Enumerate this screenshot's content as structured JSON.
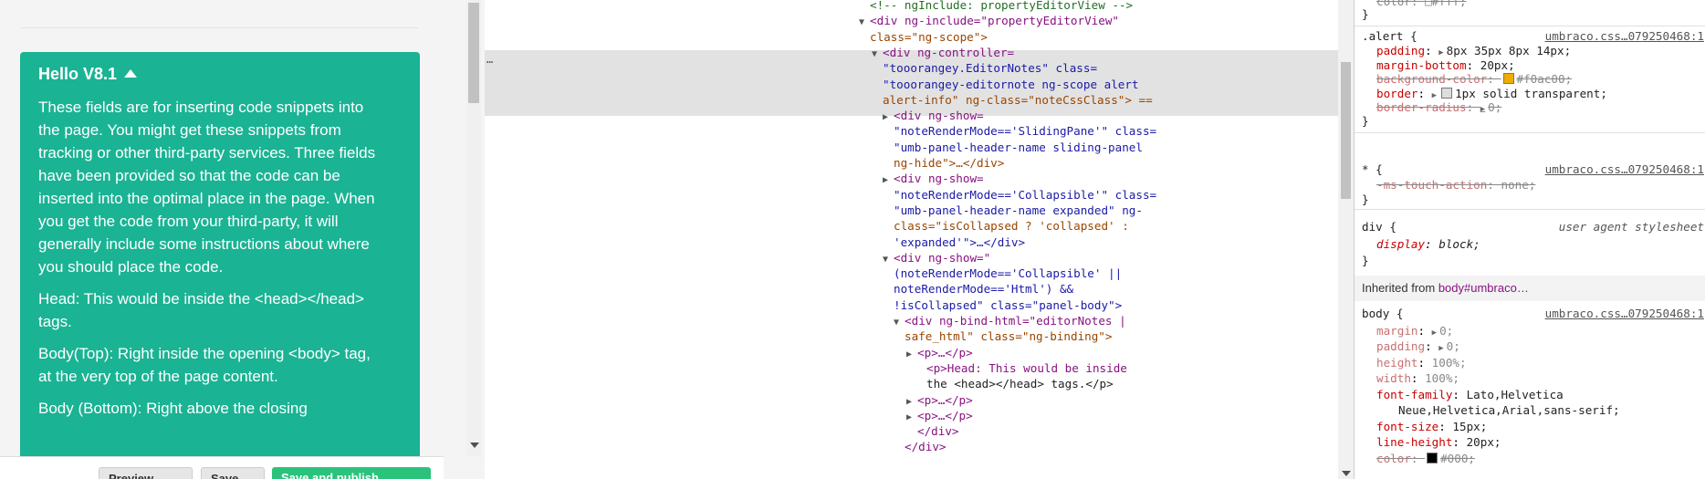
{
  "note": {
    "title": "Hello V8.1",
    "paragraphs": [
      "These fields are for inserting code snippets into the page. You might get these snippets from tracking or other third-party services. Three fields have been provided so that the code can be inserted into the optimal place in the page. When you get the code from your third-party, it will generally include some instructions about where you should place the code.",
      "Head: This would be inside the <head></head> tags.",
      "Body(Top): Right inside the opening <body> tag, at the very top of the page content.",
      "Body (Bottom): Right above the closing"
    ]
  },
  "buttons": {
    "preview": "Preview",
    "save": "Save",
    "publish": "Save and publish"
  },
  "elements_panel": {
    "dots": "…",
    "lines": [
      {
        "indent": 0,
        "tri": "",
        "html": "<!-- ngInclude: propertyEditorView -->"
      },
      {
        "indent": 0,
        "tri": "▼",
        "html": "<div ng-include=\"propertyEditorView\""
      },
      {
        "indent": 0,
        "tri": "",
        "html": "class=\"ng-scope\">"
      },
      {
        "indent": 1,
        "tri": "▼",
        "html": "<div ng-controller="
      },
      {
        "indent": 1,
        "tri": "",
        "html": "\"tooorangey.EditorNotes\" class="
      },
      {
        "indent": 1,
        "tri": "",
        "html": "\"tooorangey-editornote ng-scope alert"
      },
      {
        "indent": 1,
        "tri": "",
        "html": "alert-info\" ng-class=\"noteCssClass\"> =="
      },
      {
        "indent": 2,
        "tri": "▶",
        "html": "<div ng-show="
      },
      {
        "indent": 2,
        "tri": "",
        "html": "\"noteRenderMode=='SlidingPane'\" class="
      },
      {
        "indent": 2,
        "tri": "",
        "html": "\"umb-panel-header-name sliding-panel"
      },
      {
        "indent": 2,
        "tri": "",
        "html": "ng-hide\">…</div>"
      },
      {
        "indent": 2,
        "tri": "▶",
        "html": "<div ng-show="
      },
      {
        "indent": 2,
        "tri": "",
        "html": "\"noteRenderMode=='Collapsible'\" class="
      },
      {
        "indent": 2,
        "tri": "",
        "html": "\"umb-panel-header-name expanded\" ng-"
      },
      {
        "indent": 2,
        "tri": "",
        "html": "class=\"isCollapsed ? 'collapsed' :"
      },
      {
        "indent": 2,
        "tri": "",
        "html": "'expanded'\">…</div>"
      },
      {
        "indent": 2,
        "tri": "▼",
        "html": "<div ng-show=\""
      },
      {
        "indent": 2,
        "tri": "",
        "html": "(noteRenderMode=='Collapsible' ||"
      },
      {
        "indent": 2,
        "tri": "",
        "html": "noteRenderMode=='Html') &&"
      },
      {
        "indent": 2,
        "tri": "",
        "html": "!isCollapsed\" class=\"panel-body\">"
      },
      {
        "indent": 3,
        "tri": "▼",
        "html": "<div ng-bind-html=\"editorNotes |"
      },
      {
        "indent": 3,
        "tri": "",
        "html": "safe_html\" class=\"ng-binding\">"
      },
      {
        "indent": 4,
        "tri": "▶",
        "html": "<p>…</p>"
      },
      {
        "indent": 5,
        "tri": "",
        "html": "<p>Head: This would be inside"
      },
      {
        "indent": 5,
        "tri": "",
        "html": "the <head></head> tags.</p>"
      },
      {
        "indent": 4,
        "tri": "▶",
        "html": "<p>…</p>"
      },
      {
        "indent": 4,
        "tri": "▶",
        "html": "<p>…</p>"
      },
      {
        "indent": 4,
        "tri": "",
        "html": "</div>"
      },
      {
        "indent": 3,
        "tri": "",
        "html": "</div>"
      }
    ]
  },
  "styles_panel": {
    "top_color": "color: □#fff;",
    "alert_rule": {
      "selector": ".alert {",
      "source": "umbraco.css…079250468:1",
      "props": [
        {
          "name": "padding",
          "value": "8px 35px 8px 14px;",
          "struck": false,
          "tri": true
        },
        {
          "name": "margin-bottom",
          "value": "20px;",
          "struck": false,
          "tri": false
        },
        {
          "name": "background-color",
          "value": "#f0ac00;",
          "struck": true,
          "tri": false,
          "swatch": "#f0ac00"
        },
        {
          "name": "border",
          "value": "1px solid transparent;",
          "struck": false,
          "tri": true,
          "swatch": "transparent"
        },
        {
          "name": "border-radius",
          "value": "0;",
          "struck": true,
          "tri": true
        }
      ]
    },
    "star_rule": {
      "selector": "* {",
      "source": "umbraco.css…079250468:1",
      "props": [
        {
          "name": "-ms-touch-action",
          "value": "none;",
          "struck": true
        }
      ]
    },
    "div_rule": {
      "selector": "div {",
      "source": "user agent stylesheet",
      "props": [
        {
          "name": "display",
          "value": "block;"
        }
      ]
    },
    "inherited_label": "Inherited from",
    "inherited_selector": "body#umbraco…",
    "body_rule": {
      "selector": "body {",
      "source": "umbraco.css…079250468:1",
      "props": [
        {
          "name": "margin",
          "value": "0;",
          "struck": false,
          "tri": true,
          "dim": true
        },
        {
          "name": "padding",
          "value": "0;",
          "struck": false,
          "tri": true,
          "dim": true
        },
        {
          "name": "height",
          "value": "100%;",
          "dim": true
        },
        {
          "name": "width",
          "value": "100%;",
          "dim": true
        },
        {
          "name": "font-family",
          "value": "Lato,Helvetica",
          "cont": "Neue,Helvetica,Arial,sans-serif;"
        },
        {
          "name": "font-size",
          "value": "15px;"
        },
        {
          "name": "line-height",
          "value": "20px;"
        },
        {
          "name": "color",
          "value": "#000;",
          "struck": true,
          "swatch": "#000"
        }
      ]
    }
  },
  "colors": {
    "note_bg": "#1ab394",
    "publish_bg": "#2bc37c",
    "highlight": "#e2e2e2"
  }
}
